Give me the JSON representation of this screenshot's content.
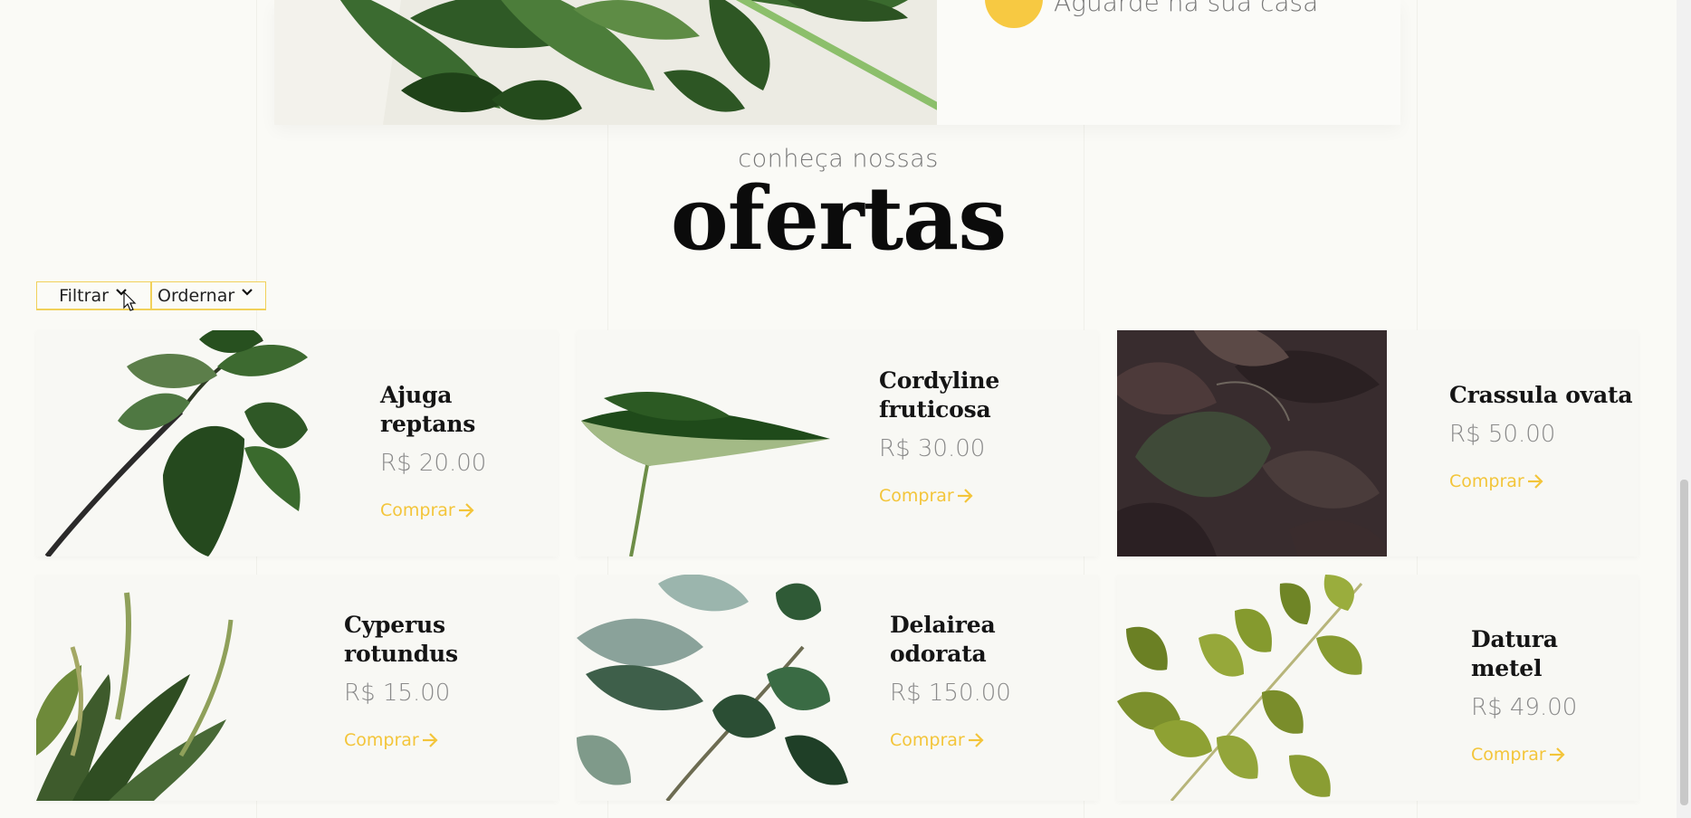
{
  "hero": {
    "caption": "Aguarde na sua casa"
  },
  "offers": {
    "subtitle": "conheça nossas",
    "title": "ofertas"
  },
  "controls": {
    "filter_label": "Filtrar",
    "order_label": "Ordernar"
  },
  "products": [
    {
      "name": "Ajuga reptans",
      "price": "R$ 20.00",
      "buy": "Comprar"
    },
    {
      "name": "Cordyline fruticosa",
      "price": "R$ 30.00",
      "buy": "Comprar"
    },
    {
      "name": "Crassula ovata",
      "price": "R$ 50.00",
      "buy": "Comprar"
    },
    {
      "name": "Cyperus rotundus",
      "price": "R$ 15.00",
      "buy": "Comprar"
    },
    {
      "name": "Delairea odorata",
      "price": "R$ 150.00",
      "buy": "Comprar"
    },
    {
      "name": "Datura metel",
      "price": "R$ 49.00",
      "buy": "Comprar"
    }
  ],
  "colors": {
    "accent": "#f3c53a",
    "background": "#fafaf6"
  }
}
